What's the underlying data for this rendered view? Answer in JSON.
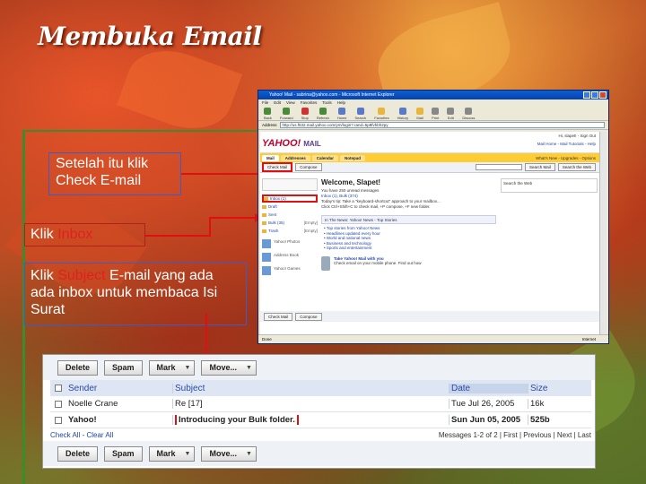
{
  "slide": {
    "title": "Membuka Email",
    "callouts": {
      "check_mail": "Setelah itu klik Check E-mail",
      "inbox_prefix": "Klik ",
      "inbox_word": "Inbox",
      "subject_prefix": "Klik ",
      "subject_word": "Subject",
      "subject_rest": " E-mail yang ada ada inbox untuk membaca Isi Surat"
    }
  },
  "browser": {
    "window_title": "Yahoo! Mail - sabrina@yahoo.com - Microsoft Internet Explorer",
    "menu": [
      "File",
      "Edit",
      "View",
      "Favorites",
      "Tools",
      "Help"
    ],
    "menu_right": "What's New - Upgrades - Options",
    "toolbar": [
      "Back",
      "Forward",
      "Stop",
      "Refresh",
      "Home",
      "Search",
      "Favorites",
      "History",
      "Mail",
      "Print",
      "Edit",
      "Discuss"
    ],
    "address_label": "Address",
    "address_value": "http://us.f532.mail.yahoo.com/ym/login?.rand=5p8fvhbh2py",
    "status_left": "Done",
    "status_right": "Internet",
    "yahoo": {
      "logo": "YAHOO!",
      "logo_mail": "MAIL",
      "user_line": "Hi, slapet! - Sign Out",
      "links": "Mail Home - Mail Tutorials - Help",
      "tabs": [
        "Mail",
        "Addresses",
        "Calendar",
        "Notepad"
      ],
      "tabs_right": "What's New - Upgrades - Options",
      "check_mail": "Check Mail",
      "compose": "Compose",
      "search_mail": "Search Mail",
      "search_web": "Search the Web",
      "folders": [
        {
          "name": "Inbox (1)",
          "count": ""
        },
        {
          "name": "Draft",
          "count": ""
        },
        {
          "name": "Sent",
          "count": ""
        },
        {
          "name": "Bulk (35)",
          "count": "[Empty]"
        },
        {
          "name": "Trash",
          "count": "[Empty]"
        }
      ],
      "ads": [
        "Yahoo! Photos",
        "Address Book",
        "Yahoo! Games"
      ],
      "welcome_title": "Welcome, Slapet!",
      "welcome_lines": [
        "You have 250 unread messages",
        "Inbox (1), Bulk (374)",
        "Today's tip: Take a \"keyboard-shortcut\" approach to your mailbox...",
        "Click Ctrl+Shift+C to check mail, +P compose, +F new folder."
      ],
      "news_header": "In The News: Yahoo! News - Top Stories",
      "stories": [
        "• Top stories from Yahoo! News",
        "• Headlines updated every hour",
        "• World and national news",
        "• Business and technology",
        "• Sports and entertainment"
      ],
      "phone_text": "Take Yahoo! Mail with you",
      "phone_sub": "Check email on your mobile phone. Find out how",
      "right_col": "Search the Web"
    }
  },
  "inbox": {
    "buttons": [
      {
        "label": "Delete",
        "dropdown": false
      },
      {
        "label": "Spam",
        "dropdown": false
      },
      {
        "label": "Mark",
        "dropdown": true
      },
      {
        "label": "Move...",
        "dropdown": true
      }
    ],
    "dropdown_glyph": "▼",
    "headers": {
      "sender": "Sender",
      "subject": "Subject",
      "date": "Date",
      "size": "Size"
    },
    "rows": [
      {
        "sender": "Noelle Crane",
        "subject": "Re [17]",
        "date": "Tue Jul 26, 2005",
        "size": "16k",
        "unread": false
      },
      {
        "sender": "Yahoo!",
        "subject": "Introducing your Bulk folder.",
        "date": "Sun Jun 05, 2005",
        "size": "525b",
        "unread": true
      }
    ],
    "footer_left_check": "Check All",
    "footer_sep": " - ",
    "footer_left_clear": "Clear All",
    "footer_right": "Messages 1-2 of 2 | First | Previous | Next | Last"
  }
}
